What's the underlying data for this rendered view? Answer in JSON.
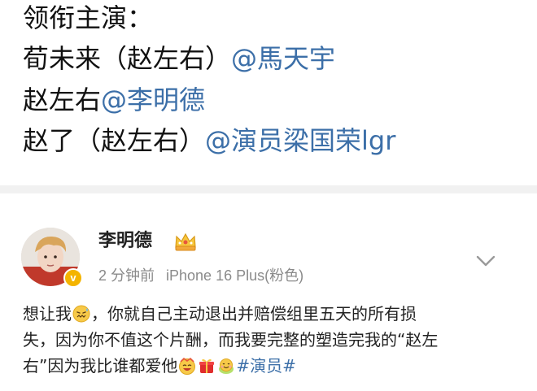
{
  "caption": {
    "line1": "领衔主演：",
    "line2_text": "荀未来（赵左右）",
    "line2_mention": "@馬天宇",
    "line3_text": "赵左右",
    "line3_mention": "@李明德",
    "line4_text": "赵了（赵左右）",
    "line4_mention": "@演员梁国荣lgr"
  },
  "post": {
    "author": "李明德",
    "time": "2 分钟前",
    "device": "iPhone 16 Plus(粉色)",
    "verified_badge": "v",
    "body_line1_a": "想让我",
    "body_line1_b": "，你就自己主动退出并赔偿组里五天的所有损",
    "body_line2": "失，因为你不值这个片酬，而我要完整的塑造完我的“赵左",
    "body_line3": "右”因为我比谁都爱他",
    "hashtag": "#演员#",
    "icons": {
      "author_badge": "crown-icon",
      "more": "chevron-down-icon",
      "emoji1": "sweating-face-emoji-icon",
      "emoji2": "laughing-face-emoji-icon",
      "emoji3": "red-gift-emoji-icon",
      "emoji4": "cake-face-emoji-icon"
    }
  },
  "colors": {
    "mention": "#3c6fa8",
    "text": "#222222",
    "meta": "#8a8a8a",
    "divider": "#f1f1f1"
  }
}
